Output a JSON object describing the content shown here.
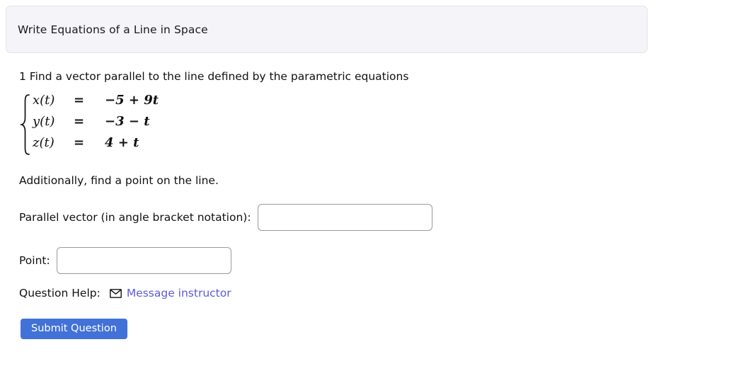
{
  "header": {
    "title": "Write Equations of a Line in Space",
    "background_color": "#f4f4f9",
    "border_color": "#e3e3ec"
  },
  "question": {
    "number": "1",
    "prompt": "1 Find a vector parallel to the line defined by the parametric equations",
    "additional_instruction": "Additionally, find a point on the line.",
    "system": {
      "brace": "{",
      "equations": [
        {
          "lhs": "x(t)",
          "eq": "=",
          "rhs_sign": "−5",
          "rhs_op": "+",
          "rhs_term": "9t",
          "rhs": "−5 + 9t"
        },
        {
          "lhs": "y(t)",
          "eq": "=",
          "rhs_sign": "−3",
          "rhs_op": "−",
          "rhs_term": "t",
          "rhs": "−3 − t"
        },
        {
          "lhs": "z(t)",
          "eq": "=",
          "rhs_sign": "4",
          "rhs_op": "+",
          "rhs_term": "t",
          "rhs": "4 + t"
        }
      ]
    }
  },
  "fields": {
    "vector": {
      "label": "Parallel vector (in angle bracket notation):",
      "value": "",
      "placeholder": ""
    },
    "point": {
      "label": "Point:",
      "value": "",
      "placeholder": ""
    }
  },
  "help": {
    "label": "Question Help:",
    "icon": "envelope-icon",
    "link_text": "Message instructor",
    "link_color": "#5c5cd6"
  },
  "submit": {
    "label": "Submit Question",
    "background_color": "#4272d7",
    "text_color": "#ffffff"
  }
}
